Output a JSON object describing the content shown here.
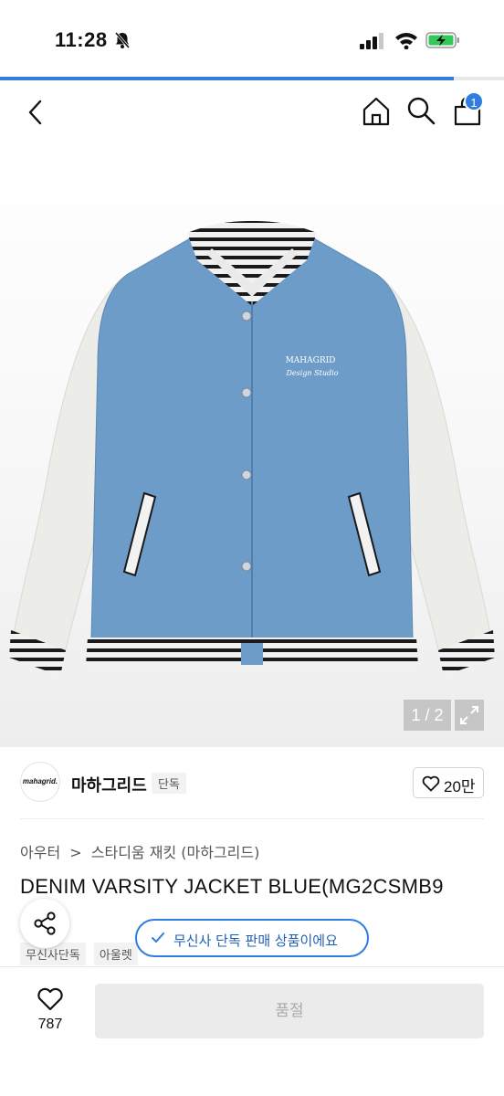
{
  "status_bar": {
    "time": "11:28"
  },
  "loading": {
    "progress": 0.9
  },
  "nav": {
    "cart_count": "1"
  },
  "gallery": {
    "counter": "1 / 2",
    "logo_text": "MAHAGRID",
    "logo_script": "Design Studio"
  },
  "brand": {
    "logo_text": "mahagrid.",
    "name": "마하그리드",
    "exclusive_tag": "단독",
    "like_count": "20만"
  },
  "breadcrumb": {
    "category": "아우터",
    "separator": ">",
    "subcategory": "스타디움 재킷 (마하그리드)"
  },
  "product": {
    "title": "DENIM VARSITY JACKET BLUE(MG2CSMB9"
  },
  "tags": [
    "무신사단독",
    "아울렛"
  ],
  "toast": {
    "text": "무신사 단독 판매 상품이에요"
  },
  "bottom_bar": {
    "wishlist_count": "787",
    "soldout_label": "품절"
  },
  "colors": {
    "accent": "#2f7de1",
    "denim": "#6e9cc8",
    "sleeve": "#eeeeea"
  }
}
